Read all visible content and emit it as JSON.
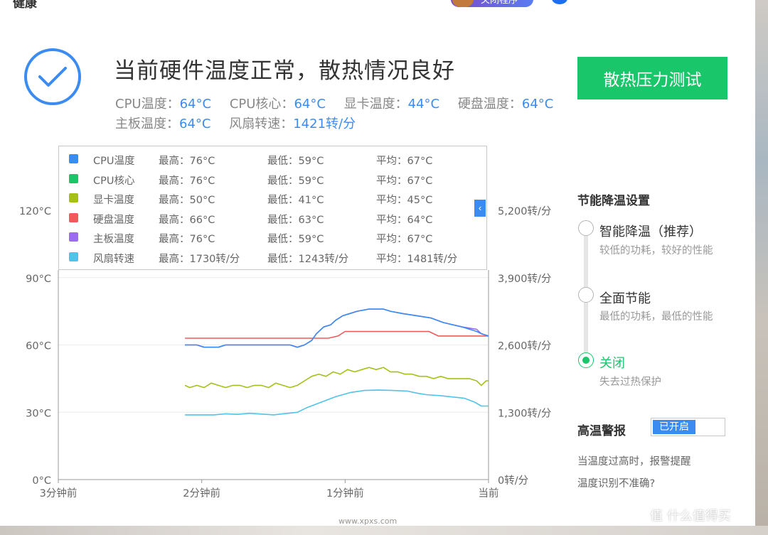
{
  "header": {
    "app_title": "健康",
    "badge_text": "关闭程序"
  },
  "status": {
    "headline": "当前硬件温度正常，散热情况良好",
    "stats": [
      {
        "label": "CPU温度：",
        "value": "64°C"
      },
      {
        "label": "CPU核心：",
        "value": "64°C"
      },
      {
        "label": "显卡温度：",
        "value": "44°C"
      },
      {
        "label": "硬盘温度：",
        "value": "64°C"
      },
      {
        "label": "主板温度：",
        "value": "64°C"
      },
      {
        "label": "风扇转速：",
        "value": "1421转/分"
      }
    ],
    "stress_button": "散热压力测试"
  },
  "legend": [
    {
      "name": "CPU温度",
      "max": "最高：76°C",
      "min": "最低：59°C",
      "avg": "平均：67°C",
      "color": "#3b8bf0"
    },
    {
      "name": "CPU核心",
      "max": "最高：76°C",
      "min": "最低：59°C",
      "avg": "平均：67°C",
      "color": "#19c66a"
    },
    {
      "name": "显卡温度",
      "max": "最高：50°C",
      "min": "最低：41°C",
      "avg": "平均：45°C",
      "color": "#a7bf1a"
    },
    {
      "name": "硬盘温度",
      "max": "最高：66°C",
      "min": "最低：63°C",
      "avg": "平均：64°C",
      "color": "#f05a5a"
    },
    {
      "name": "主板温度",
      "max": "最高：76°C",
      "min": "最低：59°C",
      "avg": "平均：67°C",
      "color": "#9b6cf0"
    },
    {
      "name": "风扇转速",
      "max": "最高：1730转/分",
      "min": "最低：1243转/分",
      "avg": "平均：1481转/分",
      "color": "#4fc3e8"
    }
  ],
  "legend_toggle_glyph": "‹",
  "chart_data": {
    "type": "line",
    "x_ticks": [
      "3分钟前",
      "2分钟前",
      "1分钟前",
      "当前"
    ],
    "x_range_seconds": [
      -180,
      0
    ],
    "y_left": {
      "ticks": [
        "0°C",
        "30°C",
        "60°C",
        "90°C",
        "120°C"
      ],
      "range": [
        0,
        120
      ]
    },
    "y_right": {
      "ticks": [
        "0转/分",
        "1,300转/分",
        "2,600转/分",
        "3,900转/分",
        "5,200转/分"
      ],
      "range": [
        0,
        5200
      ]
    },
    "grid": true,
    "series": [
      {
        "name": "硬盘温度",
        "axis": "left",
        "color": "#f05a5a",
        "points": [
          [
            -127,
            63
          ],
          [
            -67,
            63
          ],
          [
            -63,
            64
          ],
          [
            -60,
            66
          ],
          [
            -25,
            66
          ],
          [
            -21,
            64
          ],
          [
            0,
            64
          ]
        ]
      },
      {
        "name": "主板温度",
        "axis": "left",
        "color": "#9b6cf0",
        "points": [
          [
            -127,
            60
          ],
          [
            -122,
            60
          ],
          [
            -119,
            59
          ],
          [
            -113,
            59
          ],
          [
            -110,
            60
          ],
          [
            -97,
            60
          ],
          [
            -94,
            60
          ],
          [
            -92,
            60
          ],
          [
            -83,
            60
          ],
          [
            -80,
            59
          ],
          [
            -77,
            60
          ],
          [
            -74,
            62
          ],
          [
            -72,
            65
          ],
          [
            -69,
            68
          ],
          [
            -66,
            69
          ],
          [
            -64,
            71
          ],
          [
            -61,
            73
          ],
          [
            -58,
            74
          ],
          [
            -55,
            75
          ],
          [
            -50,
            76
          ],
          [
            -44,
            76
          ],
          [
            -41,
            75
          ],
          [
            -36,
            74
          ],
          [
            -30,
            73
          ],
          [
            -24,
            72
          ],
          [
            -19,
            70
          ],
          [
            -11,
            68
          ],
          [
            -5,
            67
          ],
          [
            -3,
            65
          ],
          [
            0,
            64
          ]
        ]
      },
      {
        "name": "CPU温度",
        "axis": "left",
        "color": "#3b8bf0",
        "points": [
          [
            -127,
            60
          ],
          [
            -122,
            60
          ],
          [
            -119,
            59
          ],
          [
            -113,
            59
          ],
          [
            -110,
            60
          ],
          [
            -97,
            60
          ],
          [
            -94,
            60
          ],
          [
            -92,
            60
          ],
          [
            -83,
            60
          ],
          [
            -80,
            59
          ],
          [
            -77,
            60
          ],
          [
            -74,
            62
          ],
          [
            -72,
            65
          ],
          [
            -69,
            68
          ],
          [
            -66,
            69
          ],
          [
            -64,
            71
          ],
          [
            -61,
            73
          ],
          [
            -58,
            74
          ],
          [
            -55,
            75
          ],
          [
            -50,
            76
          ],
          [
            -44,
            76
          ],
          [
            -41,
            75
          ],
          [
            -36,
            74
          ],
          [
            -30,
            73
          ],
          [
            -24,
            72
          ],
          [
            -19,
            70
          ],
          [
            -11,
            68
          ],
          [
            -5,
            66
          ],
          [
            -3,
            65
          ],
          [
            0,
            64
          ]
        ]
      },
      {
        "name": "显卡温度",
        "axis": "left",
        "color": "#a7bf1a",
        "points": [
          [
            -127,
            42
          ],
          [
            -125,
            41
          ],
          [
            -122,
            42
          ],
          [
            -119,
            41
          ],
          [
            -116,
            43
          ],
          [
            -113,
            42
          ],
          [
            -110,
            41
          ],
          [
            -107,
            42
          ],
          [
            -104,
            42
          ],
          [
            -101,
            41
          ],
          [
            -98,
            42
          ],
          [
            -95,
            42
          ],
          [
            -92,
            41
          ],
          [
            -89,
            43
          ],
          [
            -86,
            42
          ],
          [
            -83,
            41
          ],
          [
            -80,
            42
          ],
          [
            -77,
            44
          ],
          [
            -74,
            46
          ],
          [
            -71,
            47
          ],
          [
            -68,
            46
          ],
          [
            -65,
            48
          ],
          [
            -62,
            47
          ],
          [
            -59,
            49
          ],
          [
            -56,
            48
          ],
          [
            -53,
            49
          ],
          [
            -50,
            50
          ],
          [
            -47,
            49
          ],
          [
            -44,
            50
          ],
          [
            -41,
            48
          ],
          [
            -38,
            48
          ],
          [
            -35,
            47
          ],
          [
            -32,
            47
          ],
          [
            -29,
            46
          ],
          [
            -26,
            46
          ],
          [
            -23,
            45
          ],
          [
            -20,
            46
          ],
          [
            -17,
            45
          ],
          [
            -14,
            45
          ],
          [
            -11,
            45
          ],
          [
            -8,
            45
          ],
          [
            -5,
            44
          ],
          [
            -3,
            42
          ],
          [
            -1,
            44
          ],
          [
            0,
            44
          ]
        ]
      },
      {
        "name": "风扇转速",
        "axis": "right",
        "color": "#4fc3e8",
        "points": [
          [
            -127,
            1250
          ],
          [
            -115,
            1250
          ],
          [
            -110,
            1270
          ],
          [
            -105,
            1260
          ],
          [
            -100,
            1280
          ],
          [
            -95,
            1265
          ],
          [
            -90,
            1250
          ],
          [
            -86,
            1270
          ],
          [
            -80,
            1300
          ],
          [
            -76,
            1390
          ],
          [
            -72,
            1460
          ],
          [
            -68,
            1530
          ],
          [
            -64,
            1600
          ],
          [
            -58,
            1680
          ],
          [
            -52,
            1720
          ],
          [
            -46,
            1730
          ],
          [
            -40,
            1720
          ],
          [
            -34,
            1710
          ],
          [
            -30,
            1670
          ],
          [
            -26,
            1640
          ],
          [
            -20,
            1620
          ],
          [
            -14,
            1590
          ],
          [
            -10,
            1570
          ],
          [
            -6,
            1500
          ],
          [
            -3,
            1420
          ],
          [
            0,
            1420
          ]
        ]
      }
    ]
  },
  "energy_panel": {
    "title": "节能降温设置",
    "options": [
      {
        "label": "智能降温（推荐）",
        "desc": "较低的功耗，较好的性能",
        "selected": false
      },
      {
        "label": "全面节能",
        "desc": "最低的功耗，最低的性能",
        "selected": false
      },
      {
        "label": "关闭",
        "desc": "失去过热保护",
        "selected": true
      }
    ]
  },
  "alarm": {
    "title": "高温警报",
    "toggle_label": "已开启",
    "note": "当温度过高时，报警提醒",
    "link": "温度识别不准确?"
  },
  "watermark": "值 什么值得买",
  "bottom_text": "www.xpxs.com"
}
